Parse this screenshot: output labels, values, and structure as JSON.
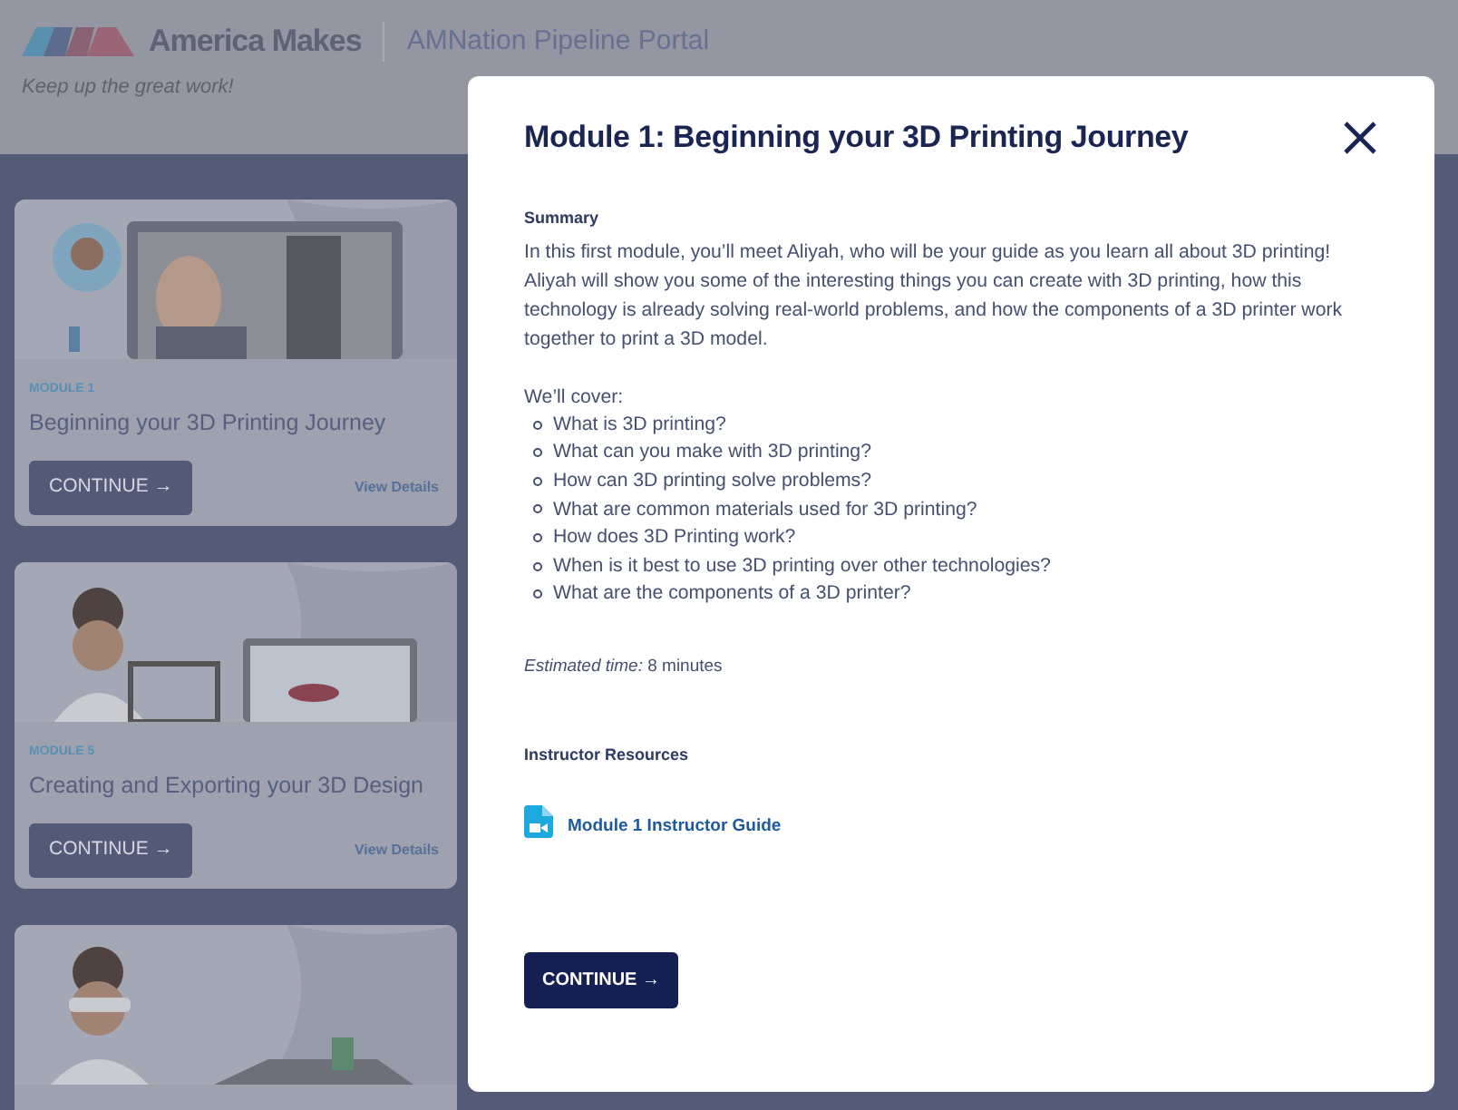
{
  "header": {
    "brand": "America Makes",
    "portal": "AMNation Pipeline Portal",
    "tagline": "Keep up the great work!"
  },
  "modules": [
    {
      "label": "MODULE 1",
      "title": "Beginning your 3D Printing Journey",
      "button": "CONTINUE →",
      "link": "View Details"
    },
    {
      "label": "MODULE 5",
      "title": "Creating and Exporting your 3D Design",
      "button": "CONTINUE →",
      "link": "View Details"
    },
    {
      "kind": "picture"
    }
  ],
  "dialog": {
    "title": "Module 1: Beginning your 3D Printing Journey",
    "summary_heading": "Summary",
    "summary": "In this first module, you’ll meet Aliyah, who will be your guide as you learn all about 3D printing! Aliyah will show you some of the interesting things you can create with 3D printing, how this technology is already solving real-world problems, and how the components of a 3D printer work together to print a 3D model.",
    "cover_intro": "We’ll cover:",
    "cover_items": [
      "What is 3D printing?",
      "What can you make with 3D printing?",
      "How can 3D printing solve problems?",
      "What are common materials used for 3D printing?",
      "How does 3D Printing work?",
      "When is it best to use 3D printing over other technologies?",
      "What are the components of a 3D printer?"
    ],
    "estimate": "*Estimated time:* 8 minutes",
    "resources_heading": "Instructor Resources",
    "resources": [
      "Module 1 Instructor Guide"
    ],
    "continue": "CONTINUE →"
  }
}
